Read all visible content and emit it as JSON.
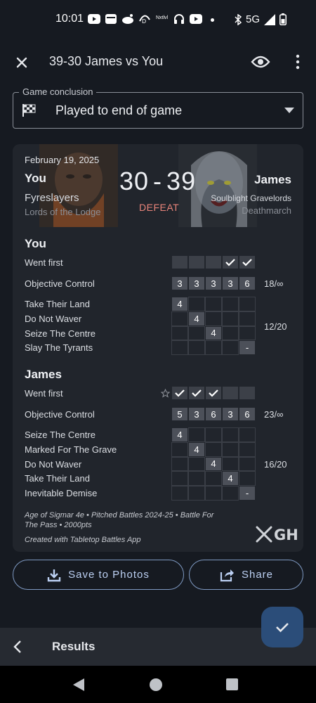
{
  "status_bar": {
    "time": "10:01",
    "network": "5G"
  },
  "app_bar": {
    "title": "39-30 James vs You",
    "close_icon": "close-icon",
    "visibility_icon": "eye-icon",
    "menu_icon": "more-vert-icon"
  },
  "conclusion": {
    "label": "Game conclusion",
    "value": "Played to end of game",
    "icon": "checkered-flag-icon"
  },
  "card": {
    "date": "February 19, 2025",
    "score_left": "30",
    "score_sep": "-",
    "score_right": "39",
    "result": "DEFEAT",
    "left_player": {
      "name": "You",
      "faction": "Fyreslayers",
      "subfaction": "Lords of the Lodge"
    },
    "right_player": {
      "name": "James",
      "faction": "Soulblight Gravelords",
      "subfaction": "Deathmarch"
    },
    "you": {
      "heading": "You",
      "went_first_label": "Went first",
      "went_first": [
        false,
        false,
        false,
        true,
        true
      ],
      "objective_label": "Objective Control",
      "objective": [
        "3",
        "3",
        "3",
        "3",
        "6"
      ],
      "objective_total": "18/∞",
      "tactics": [
        {
          "label": "Take Their Land",
          "round": 1,
          "value": "4"
        },
        {
          "label": "Do Not Waver",
          "round": 2,
          "value": "4"
        },
        {
          "label": "Seize The Centre",
          "round": 3,
          "value": "4"
        },
        {
          "label": "Slay The Tyrants",
          "round": 5,
          "value": "-"
        }
      ],
      "tactics_total": "12/20"
    },
    "james": {
      "heading": "James",
      "went_first_label": "Went first",
      "went_first": [
        true,
        true,
        true,
        false,
        false
      ],
      "objective_label": "Objective Control",
      "objective": [
        "5",
        "3",
        "6",
        "3",
        "6"
      ],
      "objective_total": "23/∞",
      "tactics": [
        {
          "label": "Seize The Centre",
          "round": 1,
          "value": "4"
        },
        {
          "label": "Marked For The Grave",
          "round": 2,
          "value": "4"
        },
        {
          "label": "Do Not Waver",
          "round": 3,
          "value": "4"
        },
        {
          "label": "Take Their Land",
          "round": 4,
          "value": "4"
        },
        {
          "label": "Inevitable Demise",
          "round": 5,
          "value": "-"
        }
      ],
      "tactics_total": "16/20"
    },
    "footer_line1": "Age of Sigmar 4e • Pitched Battles 2024-25 • Battle For",
    "footer_line2": "The Pass • 2000pts",
    "footer_line3": "Created with Tabletop Battles App",
    "logo_text": "GH"
  },
  "actions": {
    "save_label": "Save to Photos",
    "share_label": "Share"
  },
  "bottom_bar": {
    "label": "Results"
  },
  "colors": {
    "background": "#161a21",
    "card": "#21252c",
    "defeat": "#e8847a",
    "accent": "#bcd0f3",
    "fab": "#2b4d79"
  }
}
